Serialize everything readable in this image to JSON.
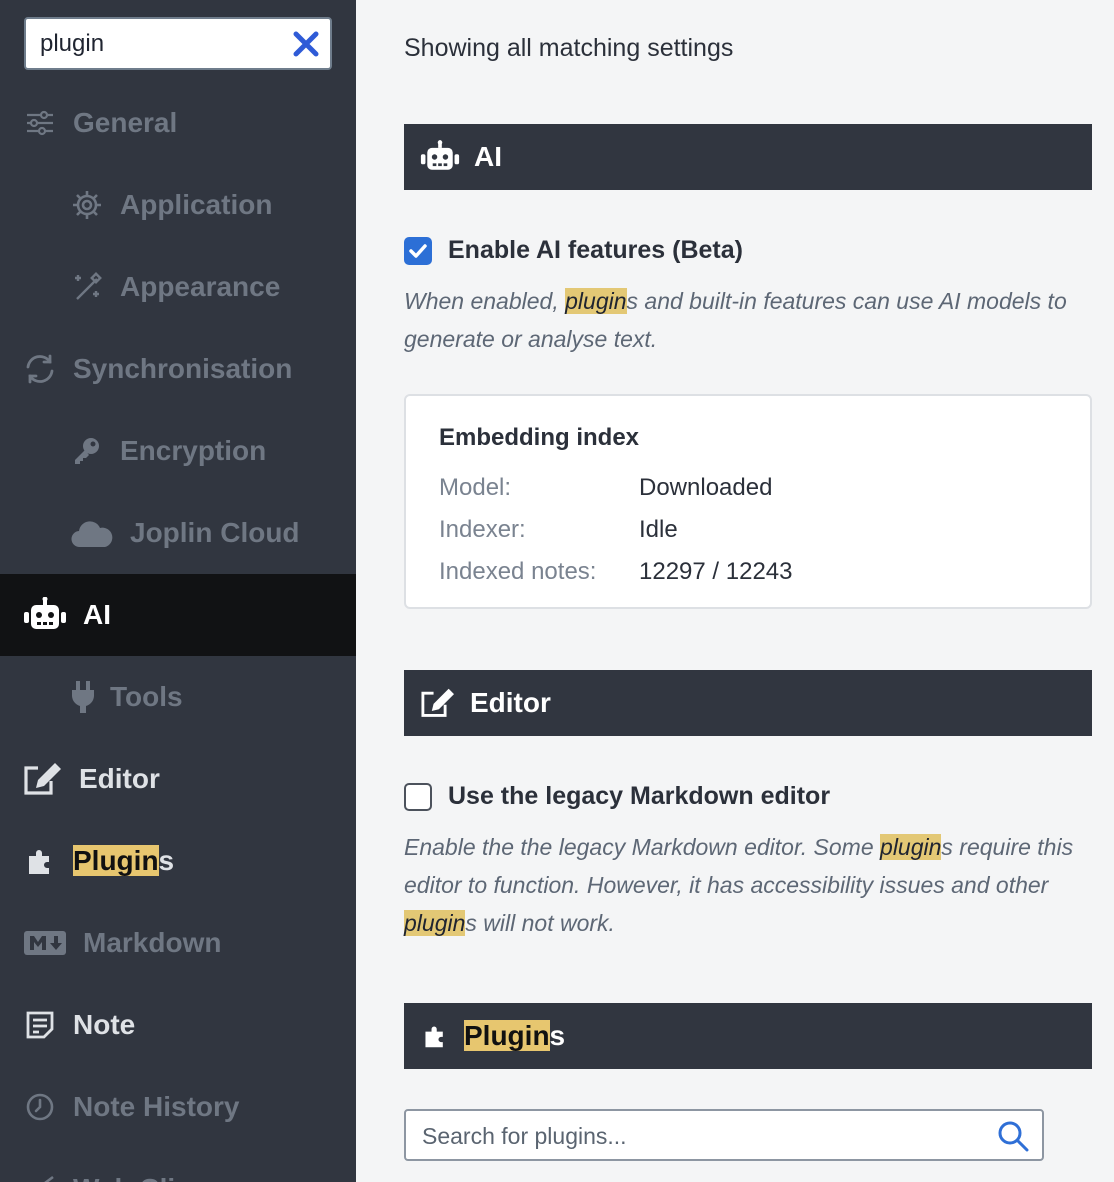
{
  "search": {
    "value": "plugin"
  },
  "sidebar": {
    "items": [
      {
        "label": "General"
      },
      {
        "label": "Application"
      },
      {
        "label": "Appearance"
      },
      {
        "label": "Synchronisation"
      },
      {
        "label": "Encryption"
      },
      {
        "label": "Joplin Cloud"
      },
      {
        "label": "AI"
      },
      {
        "label": "Tools"
      },
      {
        "label": "Editor"
      },
      {
        "label_highlight": "Plugin",
        "label_rest": "s"
      },
      {
        "label": "Markdown"
      },
      {
        "label": "Note"
      },
      {
        "label": "Note History"
      },
      {
        "label": "Web Clipper"
      }
    ]
  },
  "main": {
    "intro": "Showing all matching settings",
    "ai_section": {
      "title": "AI",
      "checkbox_label": "Enable AI features (Beta)",
      "checked": true,
      "desc_pre": "When enabled, ",
      "desc_hl": "plugin",
      "desc_post": "s and built-in features can use AI models to generate or analyse text."
    },
    "embedding": {
      "title": "Embedding index",
      "rows": [
        {
          "key": "Model:",
          "value": "Downloaded"
        },
        {
          "key": "Indexer:",
          "value": "Idle"
        },
        {
          "key": "Indexed notes:",
          "value": "12297 / 12243"
        }
      ]
    },
    "editor_section": {
      "title": "Editor",
      "checkbox_label": "Use the legacy Markdown editor",
      "checked": false,
      "desc_1": "Enable the the legacy Markdown editor. Some ",
      "desc_hl_1": "plugin",
      "desc_2": "s require this editor to function. However, it has accessibility issues and other ",
      "desc_hl_2": "plugin",
      "desc_3": "s will not work."
    },
    "plugins_section": {
      "title_highlight": "Plugin",
      "title_rest": "s",
      "search_placeholder": "Search for plugins..."
    }
  },
  "colors": {
    "sidebar_bg": "#313640",
    "active_bg": "#111214",
    "highlight": "#e7c66f",
    "accent": "#2c6fd6"
  }
}
